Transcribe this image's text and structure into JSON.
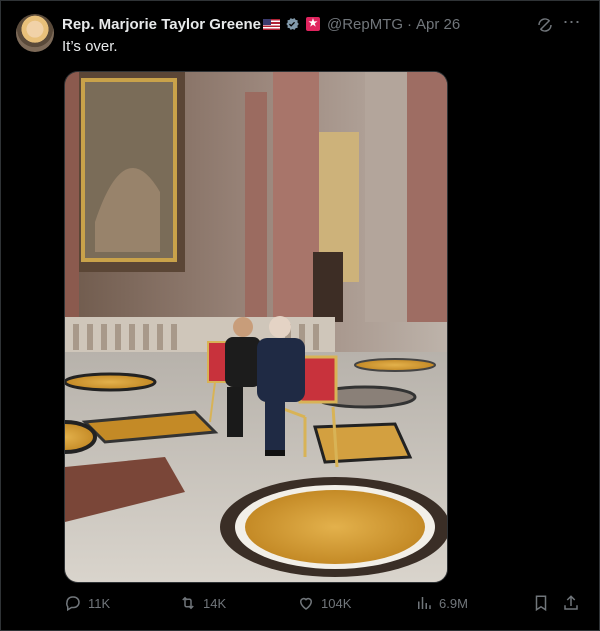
{
  "tweet": {
    "author_name": "Rep. Marjorie Taylor Greene",
    "handle": "@RepMTG",
    "separator": "·",
    "date": "Apr 26",
    "text": "It’s over.",
    "media_icon": "photo"
  },
  "icons": {
    "verified": "verified-badge-icon",
    "affiliation": "affiliation-badge-icon",
    "grok": "grok-icon",
    "more": "more-icon"
  },
  "actions": {
    "reply_count": "11K",
    "repost_count": "14K",
    "like_count": "104K",
    "view_count": "6.9M"
  },
  "colors": {
    "background": "#000000",
    "text": "#e7e9ea",
    "muted": "#71767b",
    "verified": "#829aab"
  }
}
